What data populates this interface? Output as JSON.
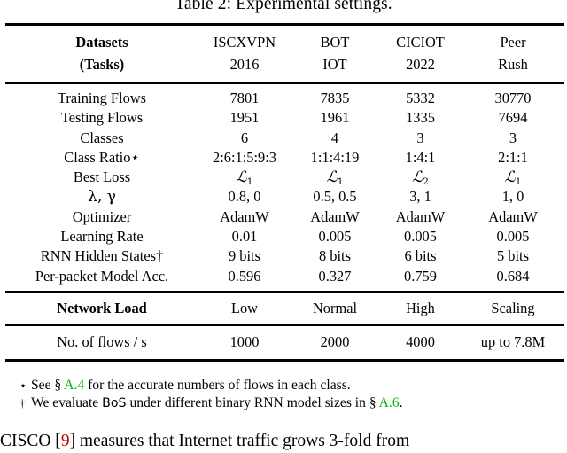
{
  "caption": "Table 2: Experimental settings.",
  "table": {
    "header": {
      "label_line1": "Datasets",
      "label_line2": "(Tasks)",
      "columns": [
        {
          "line1": "ISCXVPN",
          "line2": "2016"
        },
        {
          "line1": "BOT",
          "line2": "IOT"
        },
        {
          "line1": "CICIOT",
          "line2": "2022"
        },
        {
          "line1": "Peer",
          "line2": "Rush"
        }
      ]
    },
    "rows": [
      {
        "label": "Training Flows",
        "values": [
          "7801",
          "7835",
          "5332",
          "30770"
        ]
      },
      {
        "label": "Testing Flows",
        "values": [
          "1951",
          "1961",
          "1335",
          "7694"
        ]
      },
      {
        "label": "Classes",
        "values": [
          "6",
          "4",
          "3",
          "3"
        ]
      },
      {
        "label": "Class Ratio⋆",
        "values": [
          "2:6:1:5:9:3",
          "1:1:4:19",
          "1:4:1",
          "2:1:1"
        ]
      },
      {
        "label": "Best Loss",
        "values": [
          "ℒ1",
          "ℒ1",
          "ℒ2",
          "ℒ1"
        ],
        "math": true,
        "sub": [
          "1",
          "1",
          "2",
          "1"
        ]
      },
      {
        "label": "λ, γ",
        "values": [
          "0.8, 0",
          "0.5, 0.5",
          "3, 1",
          "1, 0"
        ]
      },
      {
        "label": "Optimizer",
        "values": [
          "AdamW",
          "AdamW",
          "AdamW",
          "AdamW"
        ]
      },
      {
        "label": "Learning Rate",
        "values": [
          "0.01",
          "0.005",
          "0.005",
          "0.005"
        ]
      },
      {
        "label": "RNN Hidden States†",
        "values": [
          "9 bits",
          "8 bits",
          "6 bits",
          "5 bits"
        ]
      },
      {
        "label": "Per-packet Model Acc.",
        "values": [
          "0.596",
          "0.327",
          "0.759",
          "0.684"
        ]
      }
    ],
    "section_row": {
      "label": "Network Load",
      "values": [
        "Low",
        "Normal",
        "High",
        "Scaling"
      ]
    },
    "flows_row": {
      "label": "No. of flows / s",
      "values": [
        "1000",
        "2000",
        "4000",
        "up to 7.8M"
      ]
    }
  },
  "footnotes": [
    {
      "mark": "⋆",
      "pre": "See § ",
      "link": "A.4",
      "post": " for the accurate numbers of flows in each class."
    },
    {
      "mark": "†",
      "pre": "We evaluate ",
      "sans": "BoS",
      "mid": " under different binary RNN model sizes in § ",
      "link": "A.6",
      "post": "."
    }
  ],
  "body_paragraph": {
    "pre": "CISCO [",
    "citation": "9",
    "post": "] measures that Internet traffic grows 3-fold from"
  },
  "colors": {
    "link_green": "#00B200",
    "citation_red": "#CC0000",
    "text": "#000000",
    "background": "#FFFFFF"
  }
}
